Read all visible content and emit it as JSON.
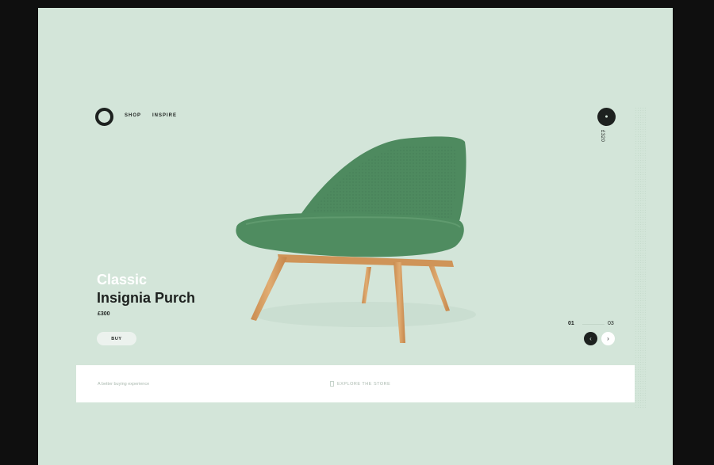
{
  "nav": {
    "logo": "logo-ring",
    "items": [
      {
        "label": "SHOP"
      },
      {
        "label": "INSPIRE"
      }
    ]
  },
  "cart": {
    "price": "£320"
  },
  "product": {
    "title_line1": "Classic",
    "title_line2": "Insignia Purch",
    "price": "£300",
    "buy_label": "BUY",
    "colors": {
      "upholstery": "#4e8a5f",
      "legs": "#d49a5e",
      "background": "#d3e5d9",
      "dark": "#1d211f"
    }
  },
  "pager": {
    "current": "01",
    "total": "03",
    "prev_icon": "chevron-left-icon",
    "next_icon": "chevron-right-icon"
  },
  "footer_strip": {
    "tagline": "A better buying experience",
    "explore_label": "EXPLORE THE STORE"
  }
}
